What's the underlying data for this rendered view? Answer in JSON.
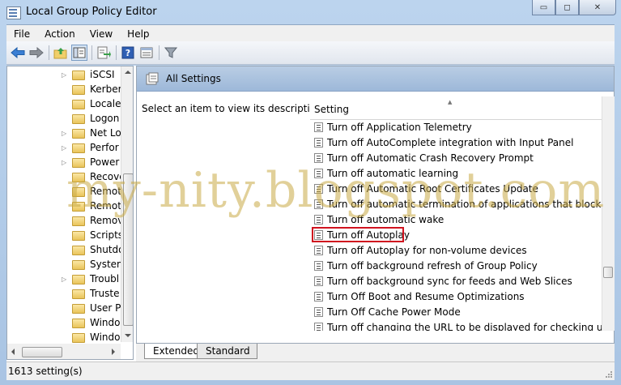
{
  "window": {
    "title": "Local Group Policy Editor",
    "minimize_glyph": "▭",
    "maximize_glyph": "◻",
    "close_glyph": "✕"
  },
  "menu": [
    "File",
    "Action",
    "View",
    "Help"
  ],
  "tree": {
    "items": [
      {
        "label": "iSCSI",
        "expandable": true
      },
      {
        "label": "Kerber",
        "expandable": false
      },
      {
        "label": "Locale",
        "expandable": false
      },
      {
        "label": "Logon",
        "expandable": false
      },
      {
        "label": "Net Lo",
        "expandable": true
      },
      {
        "label": "Perfor",
        "expandable": true
      },
      {
        "label": "Power",
        "expandable": true
      },
      {
        "label": "Recove",
        "expandable": false
      },
      {
        "label": "Remot",
        "expandable": false
      },
      {
        "label": "Remot",
        "expandable": false
      },
      {
        "label": "Remov",
        "expandable": false
      },
      {
        "label": "Scripts",
        "expandable": false
      },
      {
        "label": "Shutdo",
        "expandable": false
      },
      {
        "label": "System",
        "expandable": false
      },
      {
        "label": "Troubl",
        "expandable": true
      },
      {
        "label": "Truste",
        "expandable": false
      },
      {
        "label": "User Pr",
        "expandable": false
      },
      {
        "label": "Windo",
        "expandable": false
      },
      {
        "label": "Windo",
        "expandable": false
      }
    ]
  },
  "details": {
    "header_title": "All Settings",
    "description": "Select an item to view its description.",
    "column_label": "Setting",
    "rows": [
      "Turn off Application Telemetry",
      "Turn off AutoComplete integration with Input Panel",
      "Turn off Automatic Crash Recovery Prompt",
      "Turn off automatic learning",
      "Turn off Automatic Root Certificates Update",
      "Turn off automatic termination of applications that block or...",
      "Turn off automatic wake",
      "Turn off Autoplay",
      "Turn off Autoplay for non-volume devices",
      "Turn off background refresh of Group Policy",
      "Turn off background sync for feeds and Web Slices",
      "Turn Off Boot and Resume Optimizations",
      "Turn Off Cache Power Mode",
      "Turn off changing the URL to be displayed for checking upd..."
    ],
    "highlighted_row": "Turn off Autoplay"
  },
  "tabs": [
    "Extended",
    "Standard"
  ],
  "status": "1613 setting(s)",
  "watermark": "my-nity.blogspot.com"
}
